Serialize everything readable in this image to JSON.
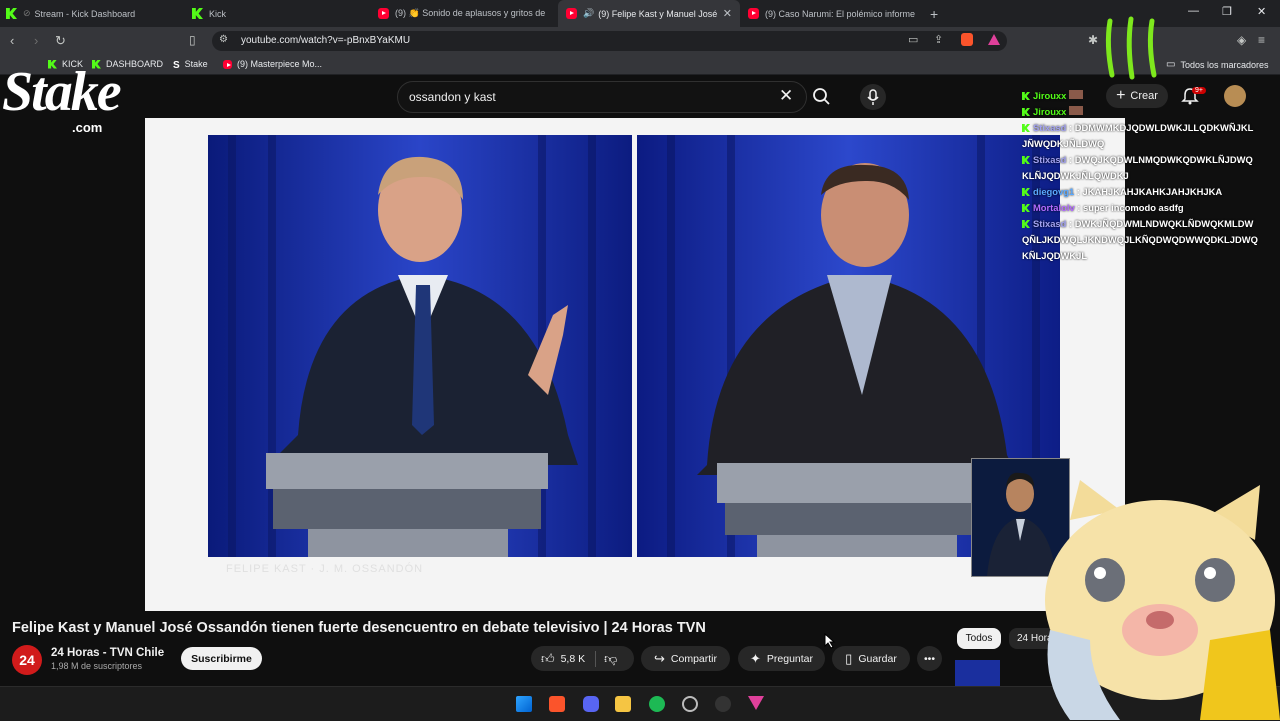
{
  "browser": {
    "tabs": [
      {
        "label": "Stream - Kick Dashboard",
        "icon": "kick-icon",
        "active": false
      },
      {
        "label": "Kick",
        "icon": "kick-icon",
        "active": false
      },
      {
        "label": "(9) 👏 Sonido de aplausos y gritos de",
        "icon": "youtube-icon",
        "active": false
      },
      {
        "label": "(9) Felipe Kast y Manuel José",
        "icon": "youtube-icon",
        "active": true
      },
      {
        "label": "(9) Caso Narumi: El polémico informe",
        "icon": "youtube-icon",
        "active": false
      }
    ],
    "url": "youtube.com/watch?v=-pBnxBYaKMU",
    "bookmarks": [
      {
        "label": "Kick",
        "icon": "kick-icon"
      },
      {
        "label": "KICK",
        "icon": "kick-icon"
      },
      {
        "label": "DASHBOARD",
        "icon": "kick-icon"
      },
      {
        "label": "Stake",
        "icon": "stake-icon"
      },
      {
        "label": "(9) Masterpiece Mo...",
        "icon": "youtube-icon"
      }
    ],
    "all_bookmarks_label": "Todos los marcadores"
  },
  "youtube": {
    "search_value": "ossandon y kast",
    "create_label": "Crear",
    "notification_count": "9+",
    "video_title": "Felipe Kast y Manuel José Ossandón tienen fuerte desencuentro en debate televisivo | 24 Horas TVN",
    "channel": {
      "logo_text": "24",
      "name": "24 Horas - TVN Chile",
      "subscribers": "1,98 M de suscriptores"
    },
    "subscribe_label": "Suscribirme",
    "likes": "5,8 K",
    "share_label": "Compartir",
    "ask_label": "Preguntar",
    "save_label": "Guardar",
    "chips": [
      "Todos",
      "24 Horas"
    ],
    "player_caption": "FELIPE KAST · J. M. OSSANDÓN"
  },
  "overlay": {
    "stake_logo": "Stake",
    "stake_domain": ".com",
    "chat": [
      {
        "user": "Jirouxx",
        "text": ""
      },
      {
        "user": "Jirouxx",
        "text": ""
      },
      {
        "user": "Stixasd",
        "text": "DDMWMKDJQDWLDWKJLLQDKWÑJKLJÑWQDKJÑLDWQ"
      },
      {
        "user": "Stixasd",
        "text": "DWQJKQDWLNMQDWKQDWKLÑJDWQKLÑJQDWKJÑLQWDKJ"
      },
      {
        "user": "diegovg1",
        "text": "JKAHJKAHJKAHKJAHJKHJKA"
      },
      {
        "user": "Mortalolv",
        "text": "super incomodo asdfg"
      },
      {
        "user": "Stixasd",
        "text": "DWKJÑQDWMLNDWQKLÑDWQKMLDWQÑLJKDWQLJKNDWQJLKÑQDWQDWWQDKLJDWQKÑLJQDWKJL"
      }
    ]
  },
  "colors": {
    "kick_green": "#53fc18",
    "youtube_red": "#ff0033",
    "debate_blue": "#1a2f9e"
  }
}
